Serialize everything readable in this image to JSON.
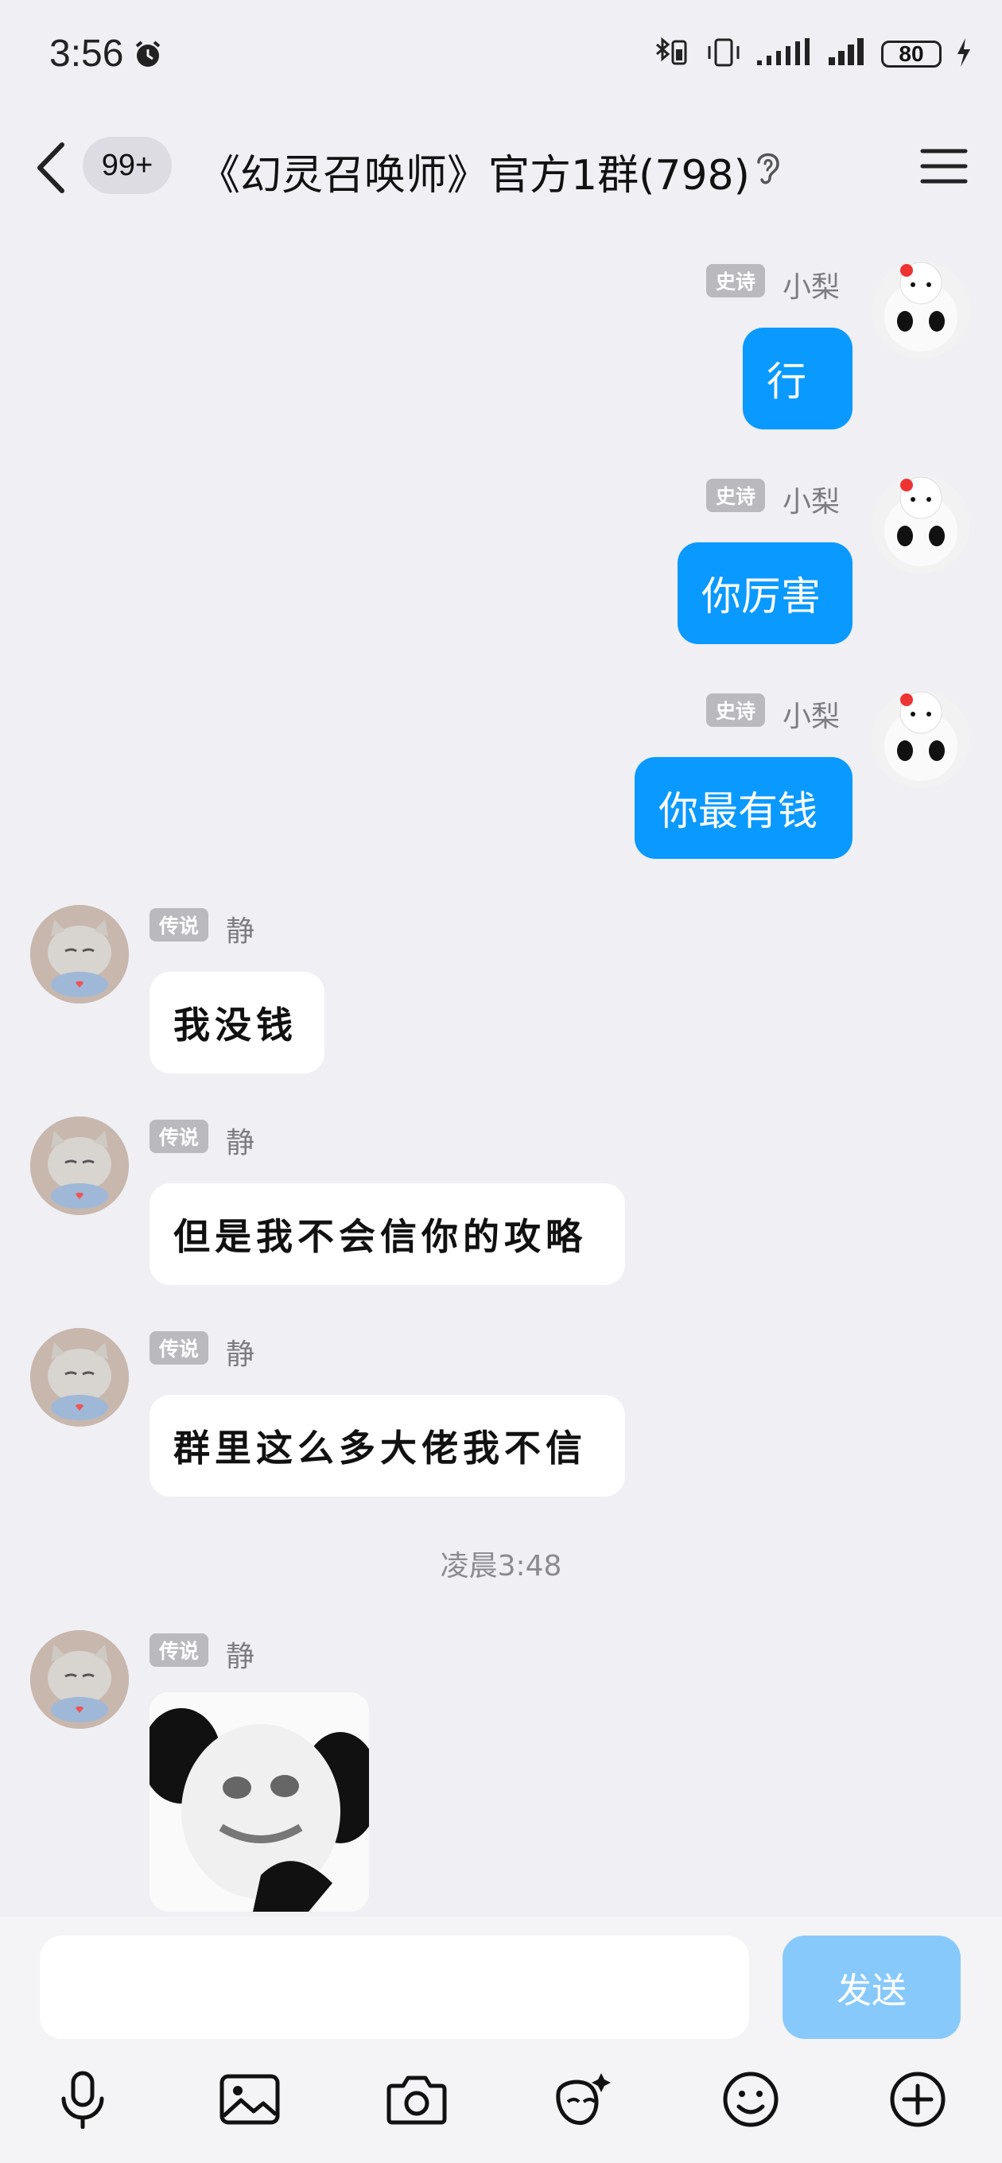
{
  "status_bar": {
    "time": "3:56",
    "battery": "80"
  },
  "header": {
    "unread_badge": "99+",
    "title": "《幻灵召唤师》官方1群(798)"
  },
  "messages": [
    {
      "side": "right",
      "tag": "史诗",
      "nick": "小梨",
      "text": "行"
    },
    {
      "side": "right",
      "tag": "史诗",
      "nick": "小梨",
      "text": "你厉害"
    },
    {
      "side": "right",
      "tag": "史诗",
      "nick": "小梨",
      "text": "你最有钱"
    },
    {
      "side": "left",
      "tag": "传说",
      "nick": "静",
      "text": "我没钱"
    },
    {
      "side": "left",
      "tag": "传说",
      "nick": "静",
      "text": "但是我不会信你的攻略"
    },
    {
      "side": "left",
      "tag": "传说",
      "nick": "静",
      "text": "群里这么多大佬我不信"
    },
    {
      "side": "left",
      "tag": "传说",
      "nick": "静",
      "text": ""
    }
  ],
  "timestamp": "凌晨3:48",
  "input": {
    "value": "",
    "send_label": "发送"
  },
  "toolbar": [
    "microphone-icon",
    "image-icon",
    "camera-icon",
    "ai-sparkle-icon",
    "emoji-icon",
    "plus-icon"
  ],
  "colors": {
    "accent": "#0a99ff",
    "send_disabled": "#88c9fb",
    "background": "#efeff4"
  }
}
